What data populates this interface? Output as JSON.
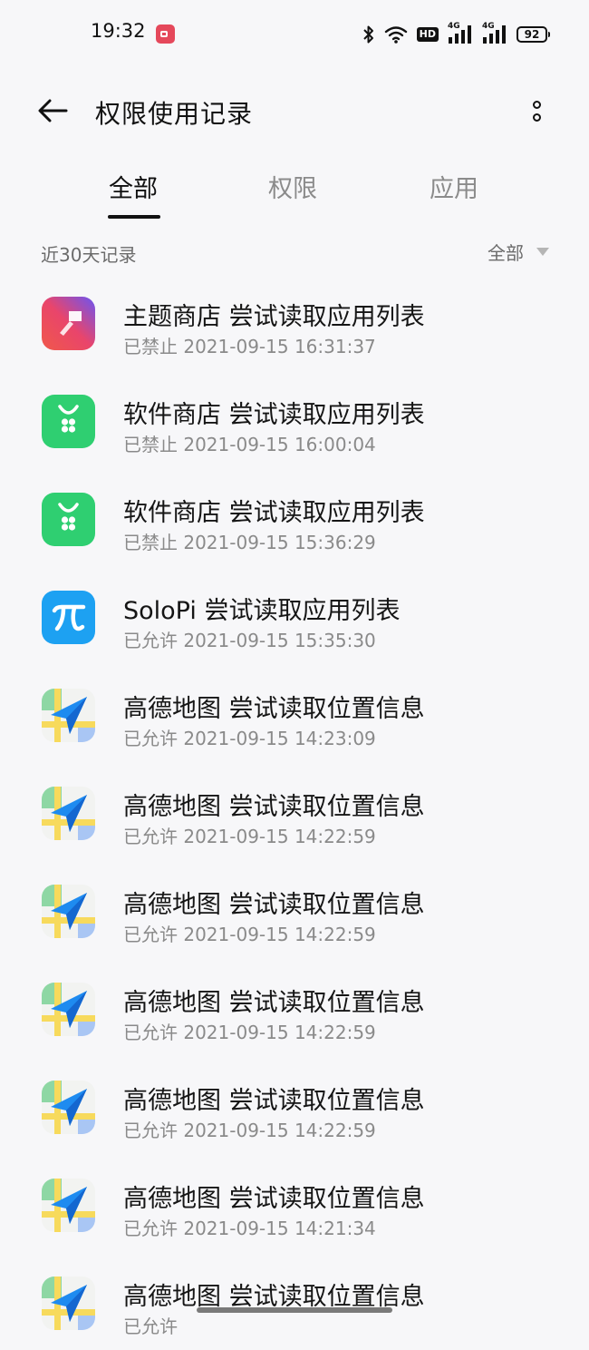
{
  "status_bar": {
    "time": "19:32",
    "hd_label": "HD",
    "network_1": "4G",
    "network_2": "4G",
    "battery": "92"
  },
  "header": {
    "title": "权限使用记录"
  },
  "tabs": [
    {
      "label": "全部",
      "active": true
    },
    {
      "label": "权限",
      "active": false
    },
    {
      "label": "应用",
      "active": false
    }
  ],
  "filter": {
    "range_label": "近30天记录",
    "selected": "全部"
  },
  "records": [
    {
      "icon": "theme-store-icon",
      "title": "主题商店 尝试读取应用列表",
      "status": "已禁止",
      "time": "2021-09-15 16:31:37"
    },
    {
      "icon": "app-store-icon",
      "title": "软件商店 尝试读取应用列表",
      "status": "已禁止",
      "time": "2021-09-15 16:00:04"
    },
    {
      "icon": "app-store-icon",
      "title": "软件商店 尝试读取应用列表",
      "status": "已禁止",
      "time": "2021-09-15 15:36:29"
    },
    {
      "icon": "solopi-icon",
      "title": "SoloPi 尝试读取应用列表",
      "status": "已允许",
      "time": "2021-09-15 15:35:30"
    },
    {
      "icon": "amap-icon",
      "title": "高德地图 尝试读取位置信息",
      "status": "已允许",
      "time": "2021-09-15 14:23:09"
    },
    {
      "icon": "amap-icon",
      "title": "高德地图 尝试读取位置信息",
      "status": "已允许",
      "time": "2021-09-15 14:22:59"
    },
    {
      "icon": "amap-icon",
      "title": "高德地图 尝试读取位置信息",
      "status": "已允许",
      "time": "2021-09-15 14:22:59"
    },
    {
      "icon": "amap-icon",
      "title": "高德地图 尝试读取位置信息",
      "status": "已允许",
      "time": "2021-09-15 14:22:59"
    },
    {
      "icon": "amap-icon",
      "title": "高德地图 尝试读取位置信息",
      "status": "已允许",
      "time": "2021-09-15 14:22:59"
    },
    {
      "icon": "amap-icon",
      "title": "高德地图 尝试读取位置信息",
      "status": "已允许",
      "time": "2021-09-15 14:21:34"
    },
    {
      "icon": "amap-icon",
      "title": "高德地图 尝试读取位置信息",
      "status": "已允许",
      "time": ""
    }
  ],
  "colors": {
    "background": "#f7f7f9",
    "app_store_green": "#2fcf71",
    "solopi_blue": "#1da1f2",
    "theme_gradient_start": "#e9456b",
    "theme_gradient_end": "#6b55f2"
  }
}
